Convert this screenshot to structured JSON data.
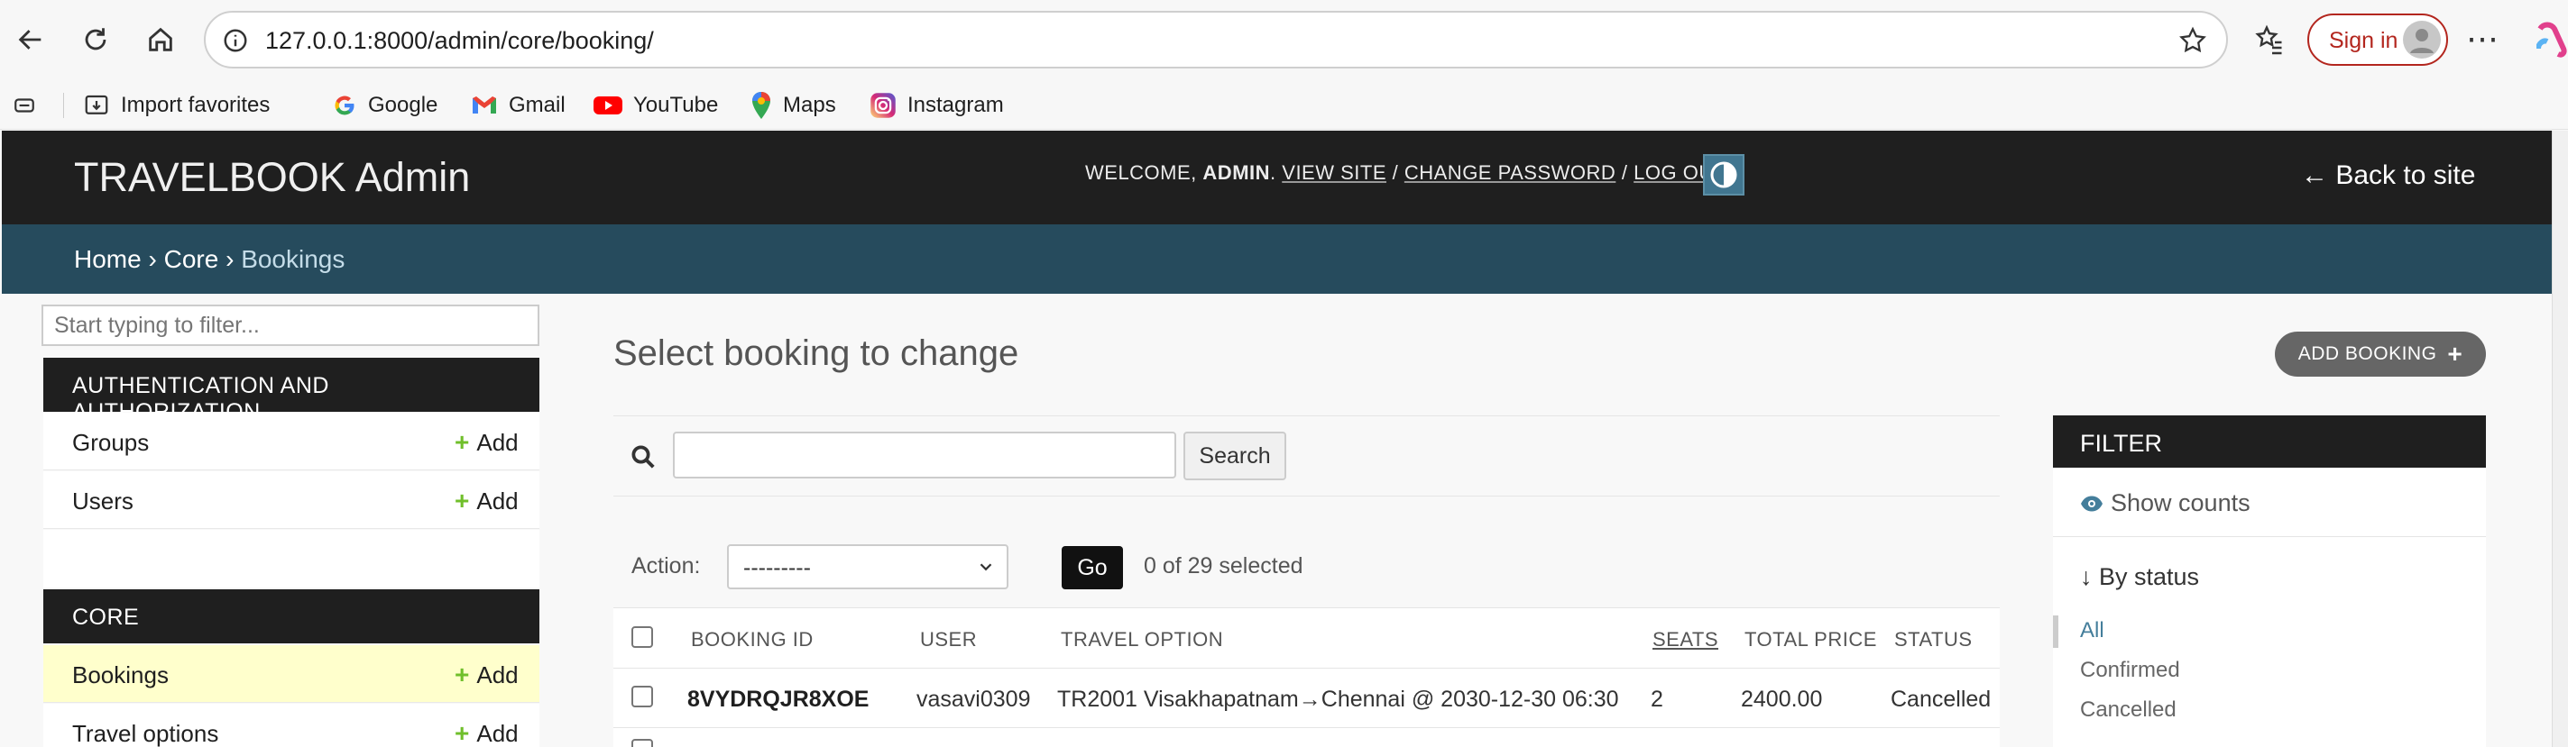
{
  "browser": {
    "url": "127.0.0.1:8000/admin/core/booking/",
    "sign_in": "Sign in",
    "bookmarks": [
      {
        "label": "Import favorites",
        "icon": "import-favorites-icon"
      },
      {
        "label": "Google",
        "icon": "google-icon"
      },
      {
        "label": "Gmail",
        "icon": "gmail-icon"
      },
      {
        "label": "YouTube",
        "icon": "youtube-icon"
      },
      {
        "label": "Maps",
        "icon": "maps-icon"
      },
      {
        "label": "Instagram",
        "icon": "instagram-icon"
      }
    ]
  },
  "header": {
    "brand": "TRAVELBOOK Admin",
    "welcome": "WELCOME,",
    "username": "ADMIN",
    "view_site": "VIEW SITE",
    "change_password": "CHANGE PASSWORD",
    "log_out": "LOG OUT",
    "back_to_site": "← Back to site"
  },
  "breadcrumbs": {
    "home": "Home",
    "app": "Core",
    "current": "Bookings",
    "separator": "›"
  },
  "sidebar": {
    "filter_placeholder": "Start typing to filter...",
    "add_label": "Add",
    "modules": [
      {
        "caption": "AUTHENTICATION AND AUTHORIZATION",
        "models": [
          "Groups",
          "Users"
        ]
      },
      {
        "caption": "CORE",
        "models": [
          "Bookings",
          "Travel options"
        ]
      }
    ]
  },
  "main": {
    "heading": "Select booking to change",
    "add_button": "ADD BOOKING",
    "search_button": "Search",
    "action_label": "Action:",
    "action_selected": "---------",
    "go_button": "Go",
    "selection_count": "0 of 29 selected",
    "columns": [
      "BOOKING ID",
      "USER",
      "TRAVEL OPTION",
      "SEATS",
      "TOTAL PRICE",
      "STATUS"
    ],
    "rows": [
      {
        "booking_id": "8VYDRQJR8XOE",
        "user": "vasavi0309",
        "travel_option": "TR2001 Visakhapatnam→Chennai @ 2030-12-30 06:30",
        "seats": "2",
        "total_price": "2400.00",
        "status": "Cancelled"
      }
    ]
  },
  "filter": {
    "title": "FILTER",
    "show_counts": "Show counts",
    "by_status": "↓ By status",
    "options": [
      "All",
      "Confirmed",
      "Cancelled"
    ],
    "selected": "All"
  },
  "colors": {
    "header_bg": "#1f1f1f",
    "breadcrumb_bg": "#264b5d",
    "link": "#447e9b",
    "add_green": "#70bf2b",
    "selected_row": "#ffffcc"
  }
}
